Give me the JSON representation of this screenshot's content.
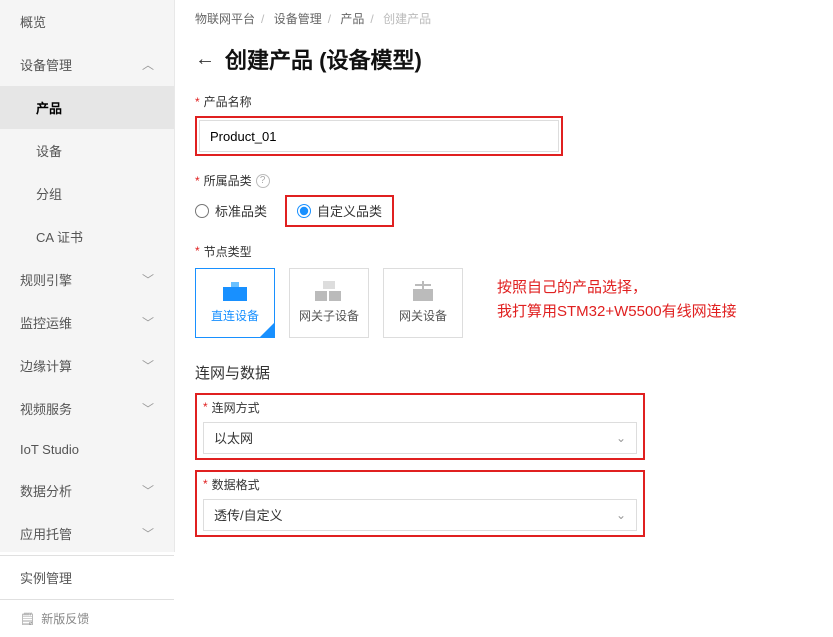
{
  "sidebar": {
    "items": [
      {
        "label": "概览",
        "expandable": false
      },
      {
        "label": "设备管理",
        "expandable": true,
        "expanded": true
      },
      {
        "label": "产品",
        "sub": true,
        "active": true
      },
      {
        "label": "设备",
        "sub": true
      },
      {
        "label": "分组",
        "sub": true
      },
      {
        "label": "CA 证书",
        "sub": true
      },
      {
        "label": "规则引擎",
        "expandable": true
      },
      {
        "label": "监控运维",
        "expandable": true
      },
      {
        "label": "边缘计算",
        "expandable": true
      },
      {
        "label": "视频服务",
        "expandable": true
      },
      {
        "label": "IoT Studio",
        "expandable": false
      },
      {
        "label": "数据分析",
        "expandable": true
      },
      {
        "label": "应用托管",
        "expandable": true
      },
      {
        "label": "实例管理",
        "expandable": false
      }
    ],
    "footer": "新版反馈"
  },
  "breadcrumb": [
    "物联网平台",
    "设备管理",
    "产品",
    "创建产品"
  ],
  "title": "创建产品 (设备模型)",
  "form": {
    "product_name_label": "产品名称",
    "product_name_value": "Product_01",
    "category_label": "所属品类",
    "category_options": [
      "标准品类",
      "自定义品类"
    ],
    "category_selected": "自定义品类",
    "node_type_label": "节点类型",
    "node_options": [
      "直连设备",
      "网关子设备",
      "网关设备"
    ],
    "node_selected": "直连设备",
    "network_section": "连网与数据",
    "network_method_label": "连网方式",
    "network_method_value": "以太网",
    "data_format_label": "数据格式",
    "data_format_value": "透传/自定义"
  },
  "annotation": {
    "line1": "按照自己的产品选择，",
    "line2": "我打算用STM32+W5500有线网连接"
  }
}
